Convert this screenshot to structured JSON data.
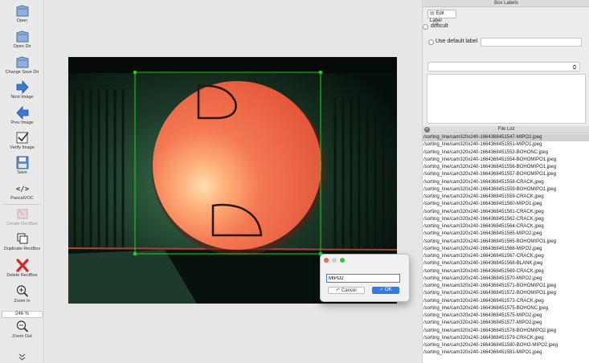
{
  "toolbar": {
    "open": "Open",
    "open_dir": "Open Dir",
    "change_save_dir": "Change Save Dir",
    "next_image": "Next Image",
    "prev_image": "Prev Image",
    "verify_image": "Verify Image",
    "save": "Save",
    "save_format": "PascalVOC",
    "create_rectbox": "Create RectBox",
    "duplicate_rectbox": "Duplicate RectBox",
    "delete_rectbox": "Delete RectBox",
    "zoom_in": "Zoom In",
    "zoom_value": "246 %",
    "zoom_out": "Zoom Out"
  },
  "box_labels": {
    "title": "Box Labels",
    "edit_label": "Edit Label",
    "difficult": "difficult",
    "use_default_label": "Use default label",
    "default_label_value": ""
  },
  "dialog": {
    "input_value": "MIPO2",
    "cancel": "Cancel",
    "ok": "OK"
  },
  "file_list": {
    "title": "File List",
    "items": [
      "/sorting_line/cam320x240-1664368451547-MIPO2.jpeg",
      "/sorting_line/cam320x240-1664368451551-MIPO1.jpeg",
      "/sorting_line/cam320x240-1664368451553-BOHONC.jpeg",
      "/sorting_line/cam320x240-1664368451554-BOHOMIPO1.jpeg",
      "/sorting_line/cam320x240-1664368451556-BOHOMIPO1.jpeg",
      "/sorting_line/cam320x240-1664368451557-BOHOMIPO1.jpeg",
      "/sorting_line/cam320x240-1664368451558-CRACK.jpeg",
      "/sorting_line/cam320x240-1664368451559-BOHOMIPO1.jpeg",
      "/sorting_line/cam320x240-1664368451559-CRACK.jpeg",
      "/sorting_line/cam320x240-1664368451560-MIPO1.jpeg",
      "/sorting_line/cam320x240-1664368451561-CRACK.jpeg",
      "/sorting_line/cam320x240-1664368451562-CRACK.jpeg",
      "/sorting_line/cam320x240-1664368451564-CRACK.jpeg",
      "/sorting_line/cam320x240-1664368451565-MIPO2.jpeg",
      "/sorting_line/cam320x240-1664368451565-BOHOMIPO1.jpeg",
      "/sorting_line/cam320x240-1664368451566-MIPO2.jpeg",
      "/sorting_line/cam320x240-1664368451567-CRACK.jpeg",
      "/sorting_line/cam320x240-1664368451568-BLANK.jpeg",
      "/sorting_line/cam320x240-1664368451569-CRACK.jpeg",
      "/sorting_line/cam320x240-1664368451570-MIPO2.jpeg",
      "/sorting_line/cam320x240-1664368451571-BOHOMIPO1.jpeg",
      "/sorting_line/cam320x240-1664368451572-BOHOMIPO1.jpeg",
      "/sorting_line/cam320x240-1664368451573-CRACK.jpeg",
      "/sorting_line/cam320x240-1664368451575-BOHONC.jpeg",
      "/sorting_line/cam320x240-1664368451575-MIPO2.jpeg",
      "/sorting_line/cam320x240-1664368451577-MIPO2.jpeg",
      "/sorting_line/cam320x240-1664368451578-BOHOMIPO2.jpeg",
      "/sorting_line/cam320x240-1664368451579-CRACK.jpeg",
      "/sorting_line/cam320x240-1664368451580-BOHO-MIPO2.jpeg",
      "/sorting_line/cam320x240-1664368451581-MIPO1.jpeg"
    ]
  }
}
